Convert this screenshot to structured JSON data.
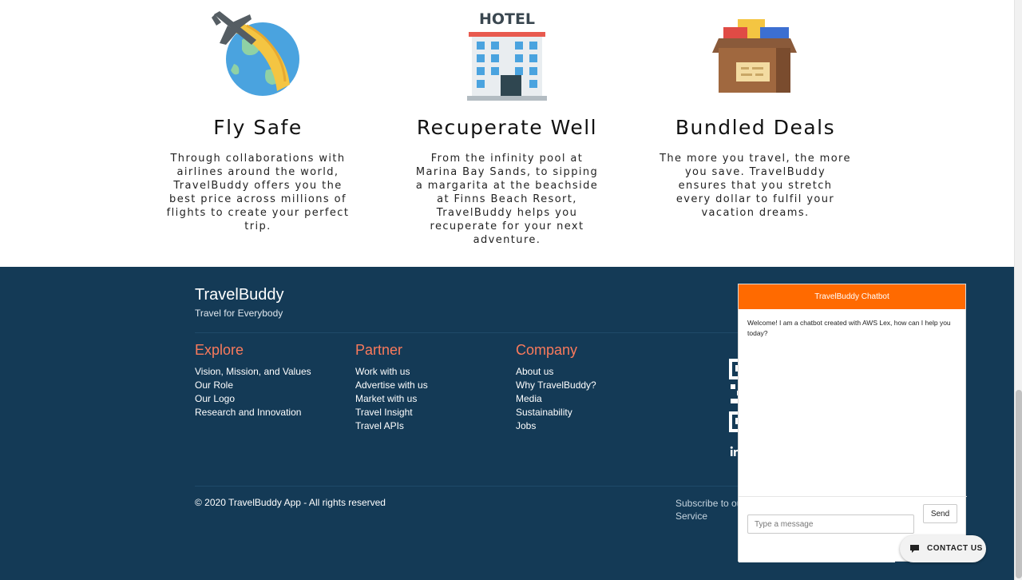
{
  "features": [
    {
      "title": "Fly Safe",
      "text": "Through collaborations with airlines around the world, TravelBuddy offers you the best price across millions of flights to create your perfect trip.",
      "icon": "airplane-globe-icon"
    },
    {
      "title": "Recuperate Well",
      "text": "From the infinity pool at Marina Bay Sands, to sipping a margarita at the beachside at Finns Beach Resort, TravelBuddy helps you recuperate for your next adventure.",
      "icon": "hotel-icon",
      "sign": "HOTEL"
    },
    {
      "title": "Bundled Deals",
      "text": "The more you travel, the more you save. TravelBuddy ensures that you stretch every dollar to fulfil your vacation dreams.",
      "icon": "package-box-icon"
    }
  ],
  "footer": {
    "brand": "TravelBuddy",
    "tagline": "Travel for Everybody",
    "columns": [
      {
        "heading": "Explore",
        "links": [
          "Vision, Mission, and Values",
          "Our Role",
          "Our Logo",
          "Research and Innovation"
        ]
      },
      {
        "heading": "Partner",
        "links": [
          "Work with us",
          "Advertise with us",
          "Market with us",
          "Travel Insight",
          "Travel APIs"
        ]
      },
      {
        "heading": "Company",
        "links": [
          "About us",
          "Why TravelBuddy?",
          "Media",
          "Sustainability",
          "Jobs"
        ]
      }
    ],
    "copyright": "© 2020 TravelBuddy App - All rights reserved",
    "subscribe": "Subscribe to ou",
    "service": "Service"
  },
  "chatbot": {
    "title": "TravelBuddy Chatbot",
    "welcome": "Welcome! I am a chatbot created with AWS Lex, how can I help you today?",
    "placeholder": "Type a message",
    "send_label": "Send"
  },
  "contact": {
    "label": "CONTACT US"
  },
  "colors": {
    "footer_bg": "#143a56",
    "accent": "#fa7a5c",
    "chat_header": "#ff6a00"
  }
}
